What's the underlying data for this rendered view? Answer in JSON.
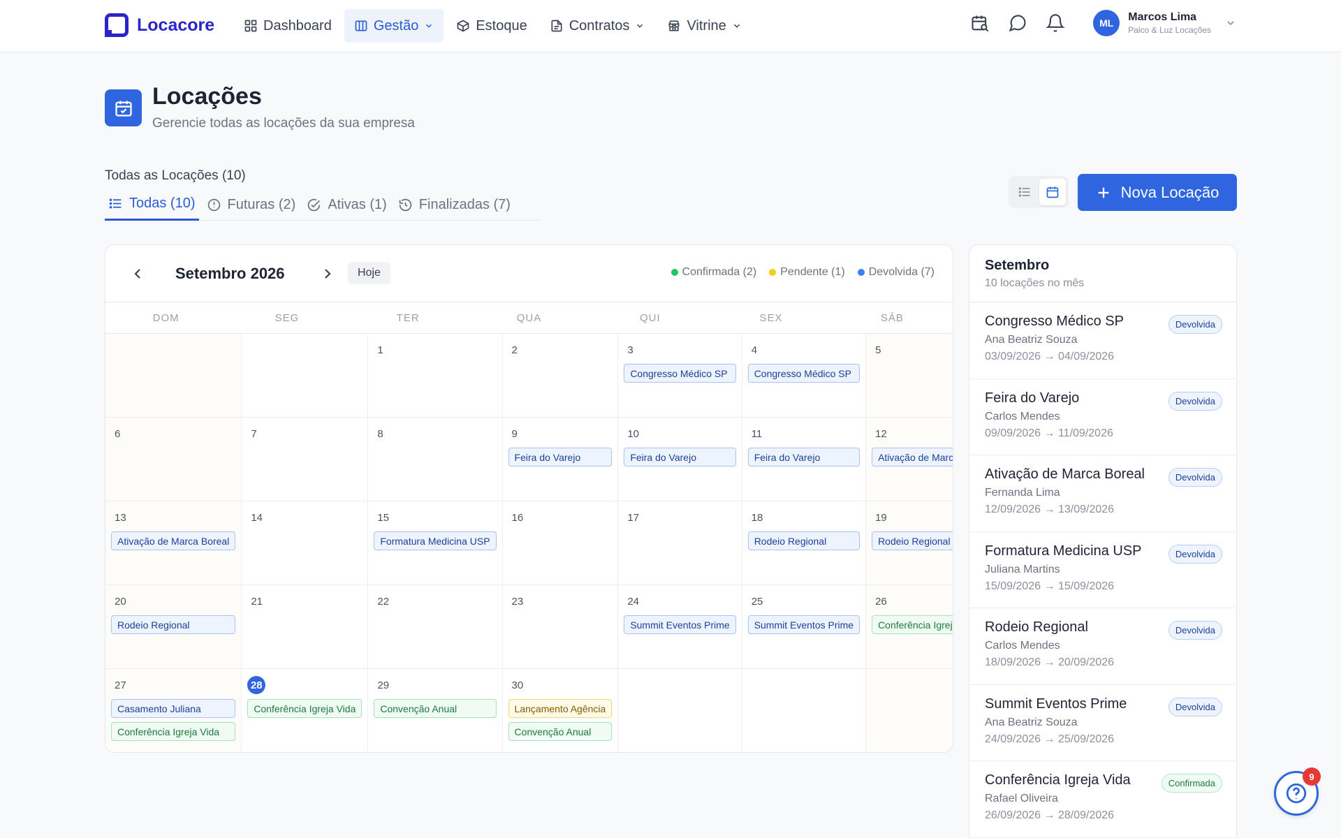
{
  "brand": {
    "name": "Locacore"
  },
  "nav": {
    "items": [
      {
        "label": "Dashboard",
        "icon": "grid-icon"
      },
      {
        "label": "Gestão",
        "icon": "building-icon"
      },
      {
        "label": "Estoque",
        "icon": "box-icon"
      },
      {
        "label": "Contratos",
        "icon": "document-icon"
      },
      {
        "label": "Vitrine",
        "icon": "store-icon"
      }
    ],
    "active": "Gestão"
  },
  "user": {
    "initials": "ML",
    "name": "Marcos Lima",
    "company": "Palco & Luz Locações"
  },
  "page": {
    "title": "Locações",
    "subtitle": "Gerencie todas as locações da sua empresa"
  },
  "tabs": {
    "heading": "Todas as Locações (10)",
    "items": [
      {
        "label": "Todas (10)",
        "icon": "list-icon"
      },
      {
        "label": "Futuras (2)",
        "icon": "clock-icon"
      },
      {
        "label": "Ativas (1)",
        "icon": "check-circle-icon"
      },
      {
        "label": "Finalizadas (7)",
        "icon": "history-icon"
      }
    ]
  },
  "actions": {
    "new_rental": "Nova Locação"
  },
  "calendar": {
    "month_label": "Setembro 2026",
    "today_label": "Hoje",
    "legend": [
      {
        "label": "Confirmada (2)",
        "color": "#22c55e"
      },
      {
        "label": "Pendente (1)",
        "color": "#facc15"
      },
      {
        "label": "Devolvida (7)",
        "color": "#3b82f6"
      }
    ],
    "weekdays": [
      "DOM",
      "SEG",
      "TER",
      "QUA",
      "QUI",
      "SEX",
      "SÁB"
    ],
    "weeks": [
      [
        {
          "day": "",
          "events": []
        },
        {
          "day": "",
          "events": []
        },
        {
          "day": "1",
          "events": []
        },
        {
          "day": "2",
          "events": []
        },
        {
          "day": "3",
          "events": [
            {
              "label": "Congresso Médico SP",
              "status": "devolvida"
            }
          ]
        },
        {
          "day": "4",
          "events": [
            {
              "label": "Congresso Médico SP",
              "status": "devolvida"
            }
          ]
        },
        {
          "day": "5",
          "events": []
        }
      ],
      [
        {
          "day": "6",
          "events": []
        },
        {
          "day": "7",
          "events": []
        },
        {
          "day": "8",
          "events": []
        },
        {
          "day": "9",
          "events": [
            {
              "label": "Feira do Varejo",
              "status": "devolvida"
            }
          ]
        },
        {
          "day": "10",
          "events": [
            {
              "label": "Feira do Varejo",
              "status": "devolvida"
            }
          ]
        },
        {
          "day": "11",
          "events": [
            {
              "label": "Feira do Varejo",
              "status": "devolvida"
            }
          ]
        },
        {
          "day": "12",
          "events": [
            {
              "label": "Ativação de Marca Boreal",
              "status": "devolvida"
            }
          ]
        }
      ],
      [
        {
          "day": "13",
          "events": [
            {
              "label": "Ativação de Marca Boreal",
              "status": "devolvida"
            }
          ]
        },
        {
          "day": "14",
          "events": []
        },
        {
          "day": "15",
          "events": [
            {
              "label": "Formatura Medicina USP",
              "status": "devolvida"
            }
          ]
        },
        {
          "day": "16",
          "events": []
        },
        {
          "day": "17",
          "events": []
        },
        {
          "day": "18",
          "events": [
            {
              "label": "Rodeio Regional",
              "status": "devolvida"
            }
          ]
        },
        {
          "day": "19",
          "events": [
            {
              "label": "Rodeio Regional",
              "status": "devolvida"
            }
          ]
        }
      ],
      [
        {
          "day": "20",
          "events": [
            {
              "label": "Rodeio Regional",
              "status": "devolvida"
            }
          ]
        },
        {
          "day": "21",
          "events": []
        },
        {
          "day": "22",
          "events": []
        },
        {
          "day": "23",
          "events": []
        },
        {
          "day": "24",
          "events": [
            {
              "label": "Summit Eventos Prime",
              "status": "devolvida"
            }
          ]
        },
        {
          "day": "25",
          "events": [
            {
              "label": "Summit Eventos Prime",
              "status": "devolvida"
            }
          ]
        },
        {
          "day": "26",
          "events": [
            {
              "label": "Conferência Igreja Vida",
              "status": "confirmada"
            }
          ]
        }
      ],
      [
        {
          "day": "27",
          "events": [
            {
              "label": "Casamento Juliana",
              "status": "devolvida"
            },
            {
              "label": "Conferência Igreja Vida",
              "status": "confirmada"
            }
          ]
        },
        {
          "day": "28",
          "today": true,
          "events": [
            {
              "label": "Conferência Igreja Vida",
              "status": "confirmada"
            }
          ]
        },
        {
          "day": "29",
          "events": [
            {
              "label": "Convenção Anual",
              "status": "confirmada"
            }
          ]
        },
        {
          "day": "30",
          "events": [
            {
              "label": "Lançamento Agência",
              "status": "pendente"
            },
            {
              "label": "Convenção Anual",
              "status": "confirmada"
            }
          ]
        },
        {
          "day": "",
          "events": []
        },
        {
          "day": "",
          "events": []
        },
        {
          "day": "",
          "events": []
        }
      ]
    ]
  },
  "side_panel": {
    "title": "Setembro",
    "subtitle": "10 locações no mês",
    "items": [
      {
        "title": "Congresso Médico SP",
        "client": "Ana Beatriz Souza",
        "dates": "03/09/2026 → 04/09/2026",
        "status_label": "Devolvida",
        "status": "devolvida"
      },
      {
        "title": "Feira do Varejo",
        "client": "Carlos Mendes",
        "dates": "09/09/2026 → 11/09/2026",
        "status_label": "Devolvida",
        "status": "devolvida"
      },
      {
        "title": "Ativação de Marca Boreal",
        "client": "Fernanda Lima",
        "dates": "12/09/2026 → 13/09/2026",
        "status_label": "Devolvida",
        "status": "devolvida"
      },
      {
        "title": "Formatura Medicina USP",
        "client": "Juliana Martins",
        "dates": "15/09/2026 → 15/09/2026",
        "status_label": "Devolvida",
        "status": "devolvida"
      },
      {
        "title": "Rodeio Regional",
        "client": "Carlos Mendes",
        "dates": "18/09/2026 → 20/09/2026",
        "status_label": "Devolvida",
        "status": "devolvida"
      },
      {
        "title": "Summit Eventos Prime",
        "client": "Ana Beatriz Souza",
        "dates": "24/09/2026 → 25/09/2026",
        "status_label": "Devolvida",
        "status": "devolvida"
      },
      {
        "title": "Conferência Igreja Vida",
        "client": "Rafael Oliveira",
        "dates": "26/09/2026 → 28/09/2026",
        "status_label": "Confirmada",
        "status": "confirmada"
      }
    ]
  },
  "help": {
    "badge_count": "9"
  }
}
